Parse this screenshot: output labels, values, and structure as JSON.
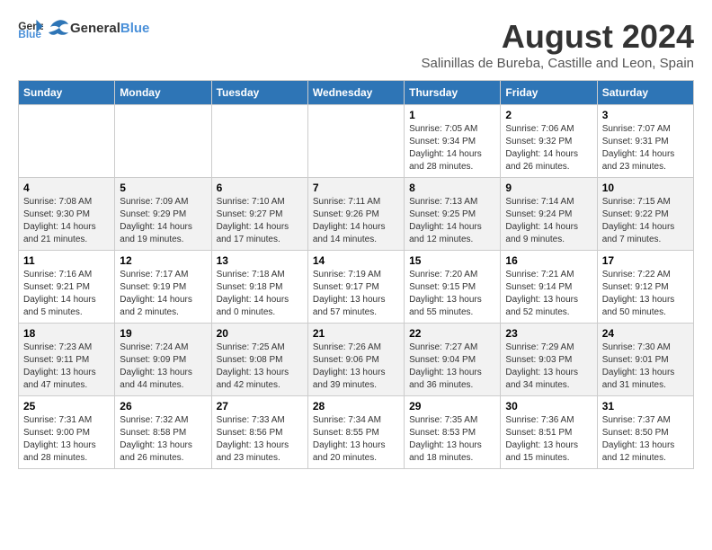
{
  "header": {
    "logo_general": "General",
    "logo_blue": "Blue",
    "title": "August 2024",
    "subtitle": "Salinillas de Bureba, Castille and Leon, Spain"
  },
  "weekdays": [
    "Sunday",
    "Monday",
    "Tuesday",
    "Wednesday",
    "Thursday",
    "Friday",
    "Saturday"
  ],
  "weeks": [
    [
      {
        "day": "",
        "info": ""
      },
      {
        "day": "",
        "info": ""
      },
      {
        "day": "",
        "info": ""
      },
      {
        "day": "",
        "info": ""
      },
      {
        "day": "1",
        "info": "Sunrise: 7:05 AM\nSunset: 9:34 PM\nDaylight: 14 hours\nand 28 minutes."
      },
      {
        "day": "2",
        "info": "Sunrise: 7:06 AM\nSunset: 9:32 PM\nDaylight: 14 hours\nand 26 minutes."
      },
      {
        "day": "3",
        "info": "Sunrise: 7:07 AM\nSunset: 9:31 PM\nDaylight: 14 hours\nand 23 minutes."
      }
    ],
    [
      {
        "day": "4",
        "info": "Sunrise: 7:08 AM\nSunset: 9:30 PM\nDaylight: 14 hours\nand 21 minutes."
      },
      {
        "day": "5",
        "info": "Sunrise: 7:09 AM\nSunset: 9:29 PM\nDaylight: 14 hours\nand 19 minutes."
      },
      {
        "day": "6",
        "info": "Sunrise: 7:10 AM\nSunset: 9:27 PM\nDaylight: 14 hours\nand 17 minutes."
      },
      {
        "day": "7",
        "info": "Sunrise: 7:11 AM\nSunset: 9:26 PM\nDaylight: 14 hours\nand 14 minutes."
      },
      {
        "day": "8",
        "info": "Sunrise: 7:13 AM\nSunset: 9:25 PM\nDaylight: 14 hours\nand 12 minutes."
      },
      {
        "day": "9",
        "info": "Sunrise: 7:14 AM\nSunset: 9:24 PM\nDaylight: 14 hours\nand 9 minutes."
      },
      {
        "day": "10",
        "info": "Sunrise: 7:15 AM\nSunset: 9:22 PM\nDaylight: 14 hours\nand 7 minutes."
      }
    ],
    [
      {
        "day": "11",
        "info": "Sunrise: 7:16 AM\nSunset: 9:21 PM\nDaylight: 14 hours\nand 5 minutes."
      },
      {
        "day": "12",
        "info": "Sunrise: 7:17 AM\nSunset: 9:19 PM\nDaylight: 14 hours\nand 2 minutes."
      },
      {
        "day": "13",
        "info": "Sunrise: 7:18 AM\nSunset: 9:18 PM\nDaylight: 14 hours\nand 0 minutes."
      },
      {
        "day": "14",
        "info": "Sunrise: 7:19 AM\nSunset: 9:17 PM\nDaylight: 13 hours\nand 57 minutes."
      },
      {
        "day": "15",
        "info": "Sunrise: 7:20 AM\nSunset: 9:15 PM\nDaylight: 13 hours\nand 55 minutes."
      },
      {
        "day": "16",
        "info": "Sunrise: 7:21 AM\nSunset: 9:14 PM\nDaylight: 13 hours\nand 52 minutes."
      },
      {
        "day": "17",
        "info": "Sunrise: 7:22 AM\nSunset: 9:12 PM\nDaylight: 13 hours\nand 50 minutes."
      }
    ],
    [
      {
        "day": "18",
        "info": "Sunrise: 7:23 AM\nSunset: 9:11 PM\nDaylight: 13 hours\nand 47 minutes."
      },
      {
        "day": "19",
        "info": "Sunrise: 7:24 AM\nSunset: 9:09 PM\nDaylight: 13 hours\nand 44 minutes."
      },
      {
        "day": "20",
        "info": "Sunrise: 7:25 AM\nSunset: 9:08 PM\nDaylight: 13 hours\nand 42 minutes."
      },
      {
        "day": "21",
        "info": "Sunrise: 7:26 AM\nSunset: 9:06 PM\nDaylight: 13 hours\nand 39 minutes."
      },
      {
        "day": "22",
        "info": "Sunrise: 7:27 AM\nSunset: 9:04 PM\nDaylight: 13 hours\nand 36 minutes."
      },
      {
        "day": "23",
        "info": "Sunrise: 7:29 AM\nSunset: 9:03 PM\nDaylight: 13 hours\nand 34 minutes."
      },
      {
        "day": "24",
        "info": "Sunrise: 7:30 AM\nSunset: 9:01 PM\nDaylight: 13 hours\nand 31 minutes."
      }
    ],
    [
      {
        "day": "25",
        "info": "Sunrise: 7:31 AM\nSunset: 9:00 PM\nDaylight: 13 hours\nand 28 minutes."
      },
      {
        "day": "26",
        "info": "Sunrise: 7:32 AM\nSunset: 8:58 PM\nDaylight: 13 hours\nand 26 minutes."
      },
      {
        "day": "27",
        "info": "Sunrise: 7:33 AM\nSunset: 8:56 PM\nDaylight: 13 hours\nand 23 minutes."
      },
      {
        "day": "28",
        "info": "Sunrise: 7:34 AM\nSunset: 8:55 PM\nDaylight: 13 hours\nand 20 minutes."
      },
      {
        "day": "29",
        "info": "Sunrise: 7:35 AM\nSunset: 8:53 PM\nDaylight: 13 hours\nand 18 minutes."
      },
      {
        "day": "30",
        "info": "Sunrise: 7:36 AM\nSunset: 8:51 PM\nDaylight: 13 hours\nand 15 minutes."
      },
      {
        "day": "31",
        "info": "Sunrise: 7:37 AM\nSunset: 8:50 PM\nDaylight: 13 hours\nand 12 minutes."
      }
    ]
  ]
}
